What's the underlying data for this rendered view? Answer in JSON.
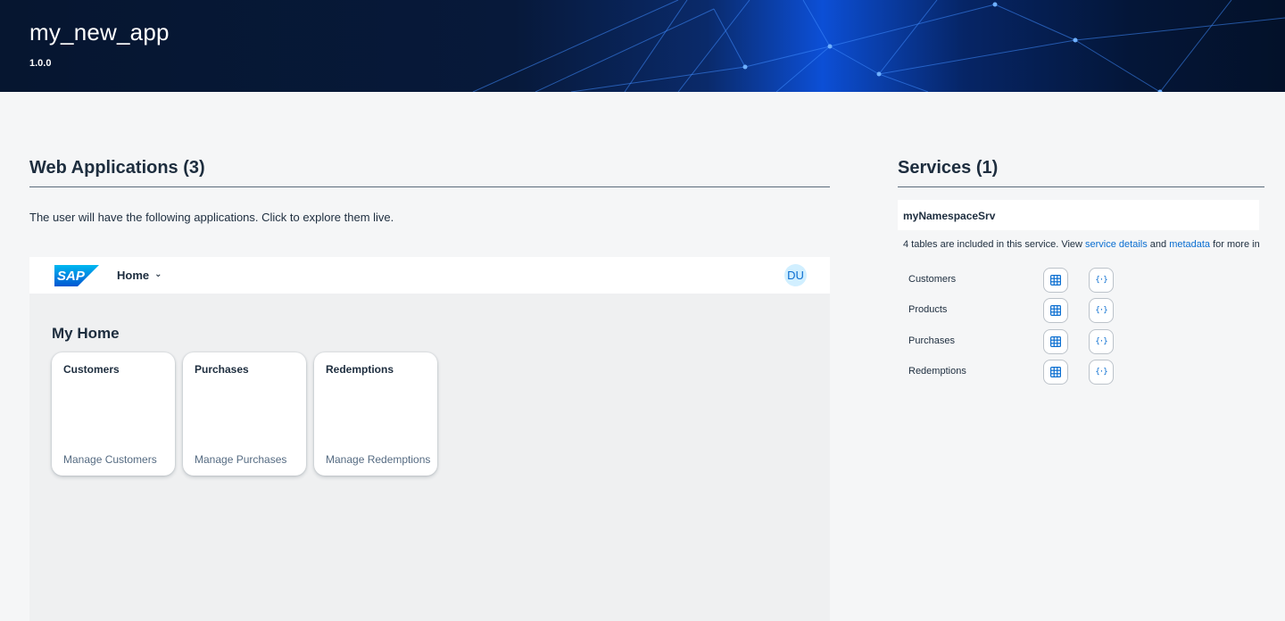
{
  "header": {
    "app_title": "my_new_app",
    "version": "1.0.0"
  },
  "web_applications": {
    "heading": "Web Applications (3)",
    "description": "The user will have the following applications. Click to explore them live.",
    "preview": {
      "logo_text": "SAP",
      "home_menu_label": "Home",
      "avatar_initials": "DU",
      "page_title": "My Home",
      "tiles": [
        {
          "title": "Customers",
          "subtitle": "Manage Customers"
        },
        {
          "title": "Purchases",
          "subtitle": "Manage Purchases"
        },
        {
          "title": "Redemptions",
          "subtitle": "Manage Redemptions"
        }
      ]
    }
  },
  "services": {
    "heading": "Services (1)",
    "service_name": "myNamespaceSrv",
    "description": {
      "prefix": "4 tables are included in this service. View ",
      "service_details_link": "service details",
      "middle": " and ",
      "metadata_link": "metadata",
      "suffix": " for more info."
    },
    "entities": [
      {
        "name": "Customers",
        "table_icon": "table-icon",
        "json_icon": "json-icon"
      },
      {
        "name": "Products",
        "table_icon": "table-icon",
        "json_icon": "json-icon"
      },
      {
        "name": "Purchases",
        "table_icon": "table-icon",
        "json_icon": "json-icon"
      },
      {
        "name": "Redemptions",
        "table_icon": "table-icon",
        "json_icon": "json-icon"
      }
    ]
  },
  "colors": {
    "accent": "#0a6ed1",
    "text": "#1d2d3e",
    "background": "#f5f6f7",
    "avatar_bg": "#d1efff"
  }
}
